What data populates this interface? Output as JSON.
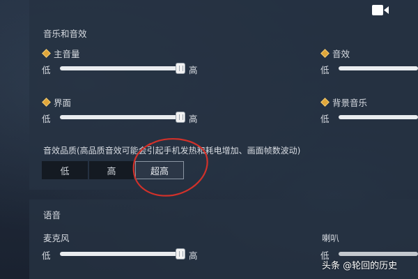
{
  "colors": {
    "accent": "#e0a63a",
    "circle": "#d1312a"
  },
  "music_section": {
    "title": "音乐和音效",
    "master_volume": {
      "label": "主音量",
      "low": "低",
      "high": "高",
      "value": 1.0,
      "icon": "diamond-icon"
    },
    "sfx": {
      "label": "音效",
      "low": "低",
      "icon": "diamond-icon"
    },
    "ui": {
      "label": "界面",
      "low": "低",
      "high": "高",
      "value": 1.0,
      "icon": "diamond-icon"
    },
    "bgm": {
      "label": "背景音乐",
      "low": "低",
      "icon": "diamond-icon"
    }
  },
  "quality": {
    "title": "音效品质(高品质音效可能会引起手机发热和耗电增加、画面帧数波动)",
    "options": [
      "低",
      "高",
      "超高"
    ],
    "selected": "超高"
  },
  "voice_section": {
    "title": "语音",
    "mic": {
      "label": "麦克风",
      "low": "低",
      "high": "高",
      "value": 1.0
    },
    "speaker": {
      "label": "喇叭",
      "low": "低"
    }
  },
  "video_icon": "video-camera-icon",
  "watermark": {
    "text": "头条 @轮回的历史"
  }
}
